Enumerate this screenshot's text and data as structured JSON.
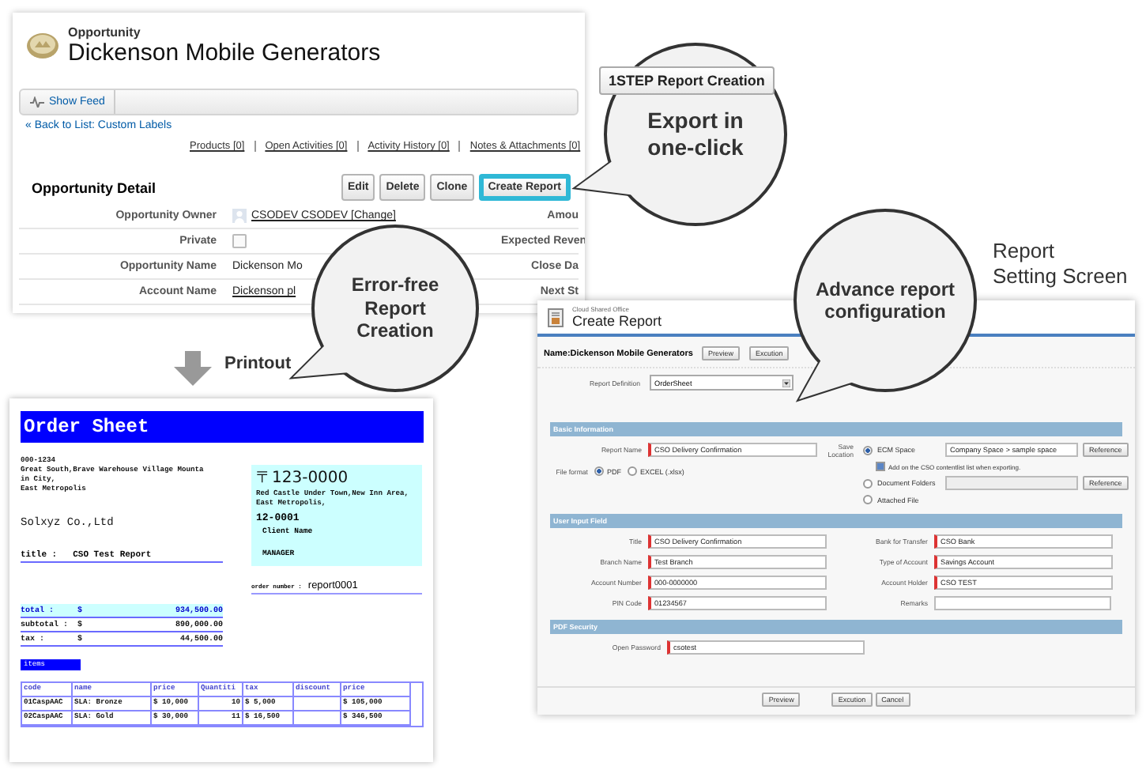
{
  "opportunity": {
    "object_label": "Opportunity",
    "title": "Dickenson Mobile Generators",
    "feed_button": "Show Feed",
    "back_link": "« Back to List: Custom Labels",
    "related_links": [
      "Products [0]",
      "Open Activities [0]",
      "Activity History [0]",
      "Notes & Attachments [0]"
    ],
    "section_title": "Opportunity Detail",
    "buttons": [
      {
        "label": "Edit",
        "highlighted": false
      },
      {
        "label": "Delete",
        "highlighted": false
      },
      {
        "label": "Clone",
        "highlighted": false
      },
      {
        "label": "Create Report",
        "highlighted": true
      }
    ],
    "fields": [
      {
        "label": "Opportunity Owner",
        "kind": "user",
        "value": "CSODEV CSODEV [Change]",
        "right_label": "Amou"
      },
      {
        "label": "Private",
        "kind": "checkbox",
        "checked": false,
        "right_label": "Expected Reven"
      },
      {
        "label": "Opportunity Name",
        "kind": "text",
        "value": "Dickenson Mo",
        "right_label": "Close Da"
      },
      {
        "label": "Account Name",
        "kind": "link",
        "value": "Dickenson pl",
        "right_label": "Next St"
      }
    ]
  },
  "step_badge": "1STEP Report Creation",
  "callouts": [
    {
      "lines": [
        "Export in",
        "one-click"
      ]
    },
    {
      "lines": [
        "Error-free",
        "Report",
        "Creation"
      ]
    },
    {
      "lines": [
        "Advance report",
        "configuration"
      ]
    }
  ],
  "printout_label": "Printout",
  "setting_screen_label": [
    "Report",
    "Setting Screen"
  ],
  "order_sheet": {
    "title": "Order Sheet",
    "sender_address": [
      "000-1234",
      "Great South,Brave Warehouse Village Mounta",
      "in City,",
      "East Metropolis"
    ],
    "company": "Solxyz Co.,Ltd",
    "title_label": "title :",
    "title_value": "CSO Test Report",
    "recipient": {
      "postal": "〒123-0000",
      "address": [
        "Red Castle Under Town,New Inn Area,",
        "East Metropolis,"
      ],
      "code": "12-0001",
      "client": "Client Name",
      "position": "MANAGER"
    },
    "order_number_label": "order number :",
    "order_number": "report0001",
    "totals": [
      {
        "kind": "total",
        "label": "total :",
        "currency": "$",
        "amount": "934,500.00"
      },
      {
        "kind": "line",
        "label": "subtotal :",
        "currency": "$",
        "amount": "890,000.00"
      },
      {
        "kind": "line",
        "label": "tax :",
        "currency": "$",
        "amount": "44,500.00"
      }
    ],
    "items_label": "items",
    "table": {
      "columns": [
        "code",
        "name",
        "price",
        "Quantiti",
        "tax",
        "discount",
        "price"
      ],
      "rows": [
        [
          "01CaspAAC",
          "SLA: Bronze",
          "$ 10,000",
          "10",
          "$ 5,000",
          null,
          "$ 105,000"
        ],
        [
          "02CaspAAC",
          "SLA: Gold",
          "$ 30,000",
          "11",
          "$ 16,500",
          null,
          "$ 346,500"
        ]
      ]
    }
  },
  "create_report": {
    "app_label": "Cloud Shared Office",
    "title": "Create Report",
    "name_label": "Name:Dickenson Mobile Generators",
    "top_buttons": [
      "Preview",
      "Excution"
    ],
    "report_definition": {
      "label": "Report Definition",
      "value": "OrderSheet"
    },
    "basic_information": {
      "heading": "Basic Information",
      "report_name": {
        "label": "Report Name",
        "value": "CSO Delivery Confirmation",
        "required": true
      },
      "file_format": {
        "label": "File format",
        "options": [
          {
            "label": "PDF",
            "selected": true
          },
          {
            "label": "EXCEL (.xlsx)",
            "selected": false
          }
        ]
      },
      "save_location": {
        "label": "Save Location",
        "options": [
          {
            "kind": "ecm",
            "label": "ECM Space",
            "selected": true,
            "value": "Company Space > sample space",
            "button": "Reference"
          },
          {
            "kind": "folders",
            "label": "Document Folders",
            "selected": false,
            "button": "Reference"
          },
          {
            "kind": "attached",
            "label": "Attached File",
            "selected": false
          }
        ],
        "add_to_list": {
          "label": "Add on the CSO contentlist list when exporting.",
          "checked": true
        }
      }
    },
    "user_input": {
      "heading": "User Input Field",
      "fields": [
        {
          "label": "Title",
          "value": "CSO Delivery Confirmation",
          "required": true
        },
        {
          "label": "Bank for Transfer",
          "value": "CSO Bank",
          "required": true
        },
        {
          "label": "Branch Name",
          "value": "Test Branch",
          "required": true
        },
        {
          "label": "Type of Account",
          "value": "Savings Account",
          "required": true
        },
        {
          "label": "Account Number",
          "value": "000-0000000",
          "required": true
        },
        {
          "label": "Account Holder",
          "value": "CSO TEST",
          "required": true
        },
        {
          "label": "PIN Code",
          "value": "01234567",
          "required": true
        },
        {
          "label": "Remarks",
          "required": false
        }
      ]
    },
    "pdf_security": {
      "heading": "PDF Security",
      "fields": [
        {
          "label": "Open Password",
          "value": "csotest",
          "required": true
        }
      ]
    },
    "bottom_buttons": [
      "Preview",
      "Excution",
      "Cancel"
    ]
  }
}
